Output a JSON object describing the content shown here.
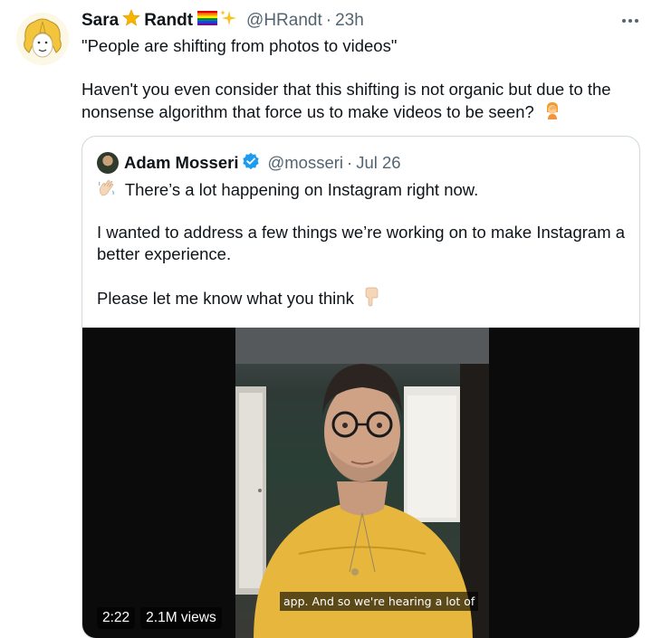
{
  "tweet": {
    "author_name_first": "Sara",
    "author_name_last": "Randt",
    "handle": "@HRandt",
    "separator": "·",
    "time": "23h",
    "text_line1": "\"People are shifting from photos to videos\"",
    "text_line2": "Haven't you even consider that this shifting is not organic but due to the",
    "text_line3": "nonsense algorithm that force us to make videos to be seen?",
    "emojis": [
      "star-emoji",
      "rainbow-flag-emoji",
      "sparkles-emoji",
      "person-facepalming-emoji"
    ]
  },
  "quoted": {
    "author_name": "Adam Mosseri",
    "handle": "@mosseri",
    "separator": "·",
    "date": "Jul 26",
    "line1": "There’s a lot happening on Instagram right now.",
    "line2": "I wanted to address a few things we’re working on to make Instagram a",
    "line3": "better experience.",
    "line4": "Please let me know what you think",
    "emojis": [
      "waving-hand-emoji",
      "pointing-down-emoji"
    ]
  },
  "video": {
    "caption": "app. And so we're hearing a lot of",
    "duration": "2:22",
    "views": "2.1M views"
  },
  "colors": {
    "text": "#0f1419",
    "secondary": "#536471",
    "border": "#cfd9de",
    "verified": "#1d9bf0"
  }
}
